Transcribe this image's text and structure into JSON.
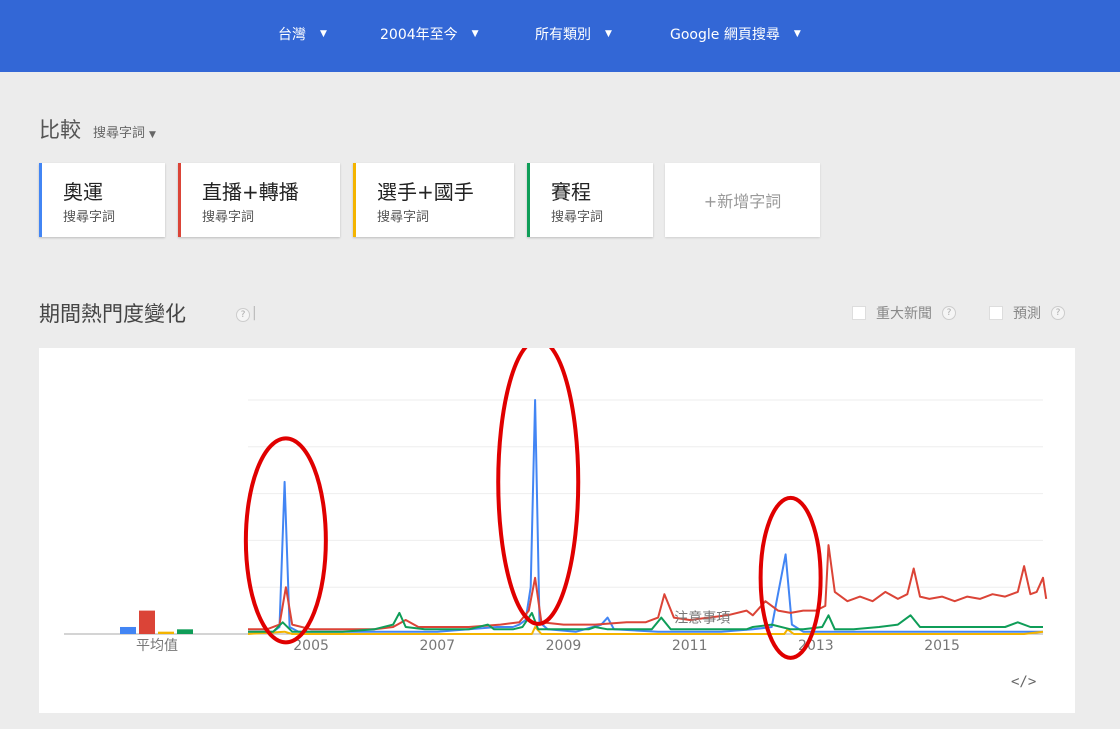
{
  "header": {
    "filters": [
      {
        "label": "台灣"
      },
      {
        "label": "2004年至今"
      },
      {
        "label": "所有類別"
      },
      {
        "label": "Google 網頁搜尋"
      }
    ]
  },
  "compare": {
    "title": "比較",
    "type_label": "搜尋字詞",
    "terms": [
      {
        "name": "奧運",
        "type": "搜尋字詞",
        "color": "#4285f4"
      },
      {
        "name": "直播+轉播",
        "type": "搜尋字詞",
        "color": "#db4437"
      },
      {
        "name": "選手+國手",
        "type": "搜尋字詞",
        "color": "#f4b400"
      },
      {
        "name": "賽程",
        "type": "搜尋字詞",
        "color": "#0f9d58"
      }
    ],
    "add_label": "+新增字詞"
  },
  "section": {
    "title": "期間熱門度變化",
    "options": [
      {
        "label": "重大新聞"
      },
      {
        "label": "預測"
      }
    ]
  },
  "chart_data": {
    "type": "line",
    "x_ticks": [
      "2005",
      "2007",
      "2009",
      "2011",
      "2013",
      "2015"
    ],
    "xlim": [
      2004.0,
      2016.6
    ],
    "ylim": [
      0,
      100
    ],
    "average_label": "平均值",
    "averages": [
      3,
      10,
      1,
      2
    ],
    "note_label": "注意事項",
    "series": [
      {
        "name": "奧運",
        "color": "#4285f4",
        "points": [
          [
            2004.0,
            1
          ],
          [
            2004.4,
            1
          ],
          [
            2004.5,
            3
          ],
          [
            2004.58,
            65
          ],
          [
            2004.66,
            3
          ],
          [
            2004.8,
            1
          ],
          [
            2005.5,
            1
          ],
          [
            2006.5,
            1
          ],
          [
            2007.0,
            1
          ],
          [
            2007.5,
            2
          ],
          [
            2007.95,
            3
          ],
          [
            2008.2,
            3
          ],
          [
            2008.3,
            4
          ],
          [
            2008.4,
            6
          ],
          [
            2008.48,
            20
          ],
          [
            2008.55,
            100
          ],
          [
            2008.62,
            5
          ],
          [
            2008.75,
            2
          ],
          [
            2009.2,
            1
          ],
          [
            2009.6,
            4
          ],
          [
            2009.7,
            7
          ],
          [
            2009.8,
            2
          ],
          [
            2010.5,
            1
          ],
          [
            2011.5,
            1
          ],
          [
            2012.0,
            2
          ],
          [
            2012.3,
            3
          ],
          [
            2012.42,
            20
          ],
          [
            2012.52,
            34
          ],
          [
            2012.62,
            4
          ],
          [
            2012.8,
            1
          ],
          [
            2014.0,
            1
          ],
          [
            2016.6,
            1
          ]
        ]
      },
      {
        "name": "直播+轉播",
        "color": "#db4437",
        "points": [
          [
            2004.0,
            2
          ],
          [
            2004.3,
            2
          ],
          [
            2004.5,
            4
          ],
          [
            2004.6,
            20
          ],
          [
            2004.7,
            4
          ],
          [
            2005.0,
            2
          ],
          [
            2005.5,
            2
          ],
          [
            2006.0,
            2
          ],
          [
            2006.3,
            3
          ],
          [
            2006.5,
            6
          ],
          [
            2006.7,
            3
          ],
          [
            2007.0,
            3
          ],
          [
            2007.5,
            3
          ],
          [
            2008.0,
            4
          ],
          [
            2008.3,
            5
          ],
          [
            2008.45,
            10
          ],
          [
            2008.55,
            24
          ],
          [
            2008.65,
            5
          ],
          [
            2009.0,
            4
          ],
          [
            2009.5,
            4
          ],
          [
            2010.0,
            5
          ],
          [
            2010.3,
            5
          ],
          [
            2010.5,
            7
          ],
          [
            2010.6,
            17
          ],
          [
            2010.75,
            7
          ],
          [
            2011.0,
            6
          ],
          [
            2011.3,
            7
          ],
          [
            2011.6,
            8
          ],
          [
            2011.9,
            10
          ],
          [
            2012.0,
            8
          ],
          [
            2012.2,
            14
          ],
          [
            2012.4,
            10
          ],
          [
            2012.6,
            9
          ],
          [
            2012.8,
            10
          ],
          [
            2013.0,
            10
          ],
          [
            2013.15,
            12
          ],
          [
            2013.2,
            38
          ],
          [
            2013.3,
            18
          ],
          [
            2013.5,
            14
          ],
          [
            2013.7,
            16
          ],
          [
            2013.9,
            14
          ],
          [
            2014.1,
            18
          ],
          [
            2014.3,
            15
          ],
          [
            2014.45,
            17
          ],
          [
            2014.55,
            28
          ],
          [
            2014.65,
            16
          ],
          [
            2014.8,
            15
          ],
          [
            2015.0,
            16
          ],
          [
            2015.2,
            14
          ],
          [
            2015.4,
            16
          ],
          [
            2015.6,
            15
          ],
          [
            2015.8,
            17
          ],
          [
            2016.0,
            16
          ],
          [
            2016.2,
            18
          ],
          [
            2016.3,
            29
          ],
          [
            2016.4,
            17
          ],
          [
            2016.5,
            18
          ],
          [
            2016.6,
            24
          ],
          [
            2016.65,
            15
          ]
        ]
      },
      {
        "name": "選手+國手",
        "color": "#f4b400",
        "points": [
          [
            2004.0,
            0
          ],
          [
            2004.58,
            1
          ],
          [
            2004.7,
            0
          ],
          [
            2008.5,
            0
          ],
          [
            2008.55,
            3
          ],
          [
            2008.65,
            0
          ],
          [
            2012.5,
            0
          ],
          [
            2012.55,
            2
          ],
          [
            2012.65,
            0
          ],
          [
            2016.3,
            0
          ],
          [
            2016.6,
            1
          ]
        ]
      },
      {
        "name": "賽程",
        "color": "#0f9d58",
        "points": [
          [
            2004.0,
            1
          ],
          [
            2004.4,
            1
          ],
          [
            2004.55,
            5
          ],
          [
            2004.7,
            1
          ],
          [
            2005.5,
            1
          ],
          [
            2006.0,
            2
          ],
          [
            2006.3,
            4
          ],
          [
            2006.4,
            9
          ],
          [
            2006.5,
            3
          ],
          [
            2006.8,
            2
          ],
          [
            2007.2,
            2
          ],
          [
            2007.5,
            2
          ],
          [
            2007.8,
            4
          ],
          [
            2007.9,
            2
          ],
          [
            2008.2,
            2
          ],
          [
            2008.35,
            3
          ],
          [
            2008.5,
            9
          ],
          [
            2008.6,
            2
          ],
          [
            2009.0,
            2
          ],
          [
            2009.4,
            2
          ],
          [
            2009.5,
            3
          ],
          [
            2009.7,
            2
          ],
          [
            2010.0,
            2
          ],
          [
            2010.4,
            2
          ],
          [
            2010.55,
            7
          ],
          [
            2010.7,
            2
          ],
          [
            2011.0,
            2
          ],
          [
            2011.5,
            2
          ],
          [
            2011.9,
            2
          ],
          [
            2012.0,
            3
          ],
          [
            2012.3,
            4
          ],
          [
            2012.6,
            2
          ],
          [
            2012.8,
            2
          ],
          [
            2013.1,
            3
          ],
          [
            2013.2,
            8
          ],
          [
            2013.3,
            2
          ],
          [
            2013.6,
            2
          ],
          [
            2014.0,
            3
          ],
          [
            2014.3,
            4
          ],
          [
            2014.5,
            8
          ],
          [
            2014.65,
            3
          ],
          [
            2015.0,
            3
          ],
          [
            2015.3,
            3
          ],
          [
            2015.8,
            3
          ],
          [
            2016.0,
            3
          ],
          [
            2016.2,
            5
          ],
          [
            2016.4,
            3
          ],
          [
            2016.6,
            3
          ]
        ]
      }
    ]
  },
  "annotations": {
    "highlight_color": "#e00000",
    "ellipses": [
      {
        "x_center": 2004.6,
        "y_center": 40
      },
      {
        "x_center": 2008.6,
        "y_center": 65
      },
      {
        "x_center": 2012.6,
        "y_center": 24
      }
    ]
  },
  "embed_label": "</>"
}
